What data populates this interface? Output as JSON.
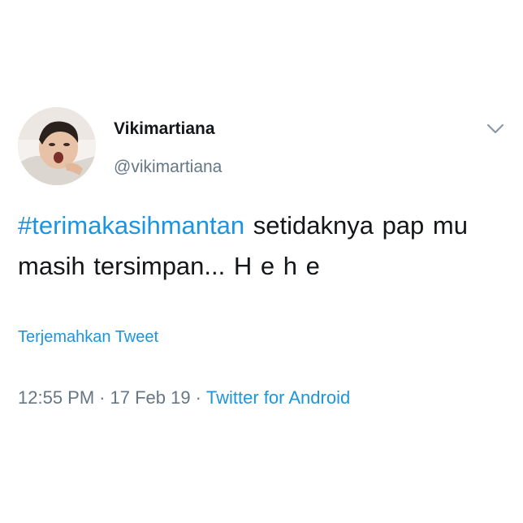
{
  "user": {
    "display_name": "Vikimartiana",
    "handle": "@vikimartiana"
  },
  "icons": {
    "menu": "chevron-down-icon",
    "avatar": "profile-photo"
  },
  "tweet": {
    "hashtag": "#terimakasihmantan",
    "text_rest": " setidaknya pap mu masih tersimpan... H e h e"
  },
  "translate_label": "Terjemahkan Tweet",
  "meta": {
    "time": "12:55 PM",
    "separator": "·",
    "date": "17 Feb 19",
    "source": "Twitter for Android"
  },
  "colors": {
    "link": "#1b95e0",
    "text": "#14171a",
    "secondary": "#657786"
  }
}
